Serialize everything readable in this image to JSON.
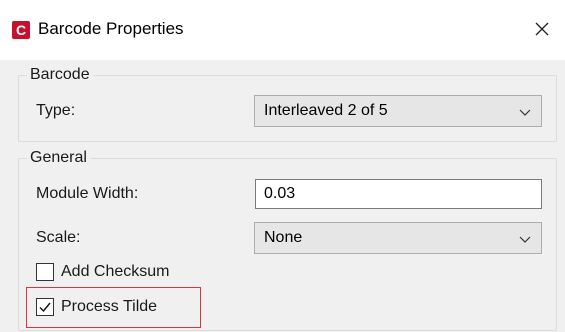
{
  "window": {
    "app_icon_letter": "C",
    "title": "Barcode Properties"
  },
  "barcode_group": {
    "legend": "Barcode",
    "type_label": "Type:",
    "type_value": "Interleaved 2 of 5"
  },
  "general_group": {
    "legend": "General",
    "module_width_label": "Module Width:",
    "module_width_value": "0.03",
    "scale_label": "Scale:",
    "scale_value": "None",
    "add_checksum_label": "Add Checksum",
    "add_checksum_checked": false,
    "process_tilde_label": "Process Tilde",
    "process_tilde_checked": true
  },
  "colors": {
    "brand": "#c8102e",
    "highlight": "#d9363e",
    "dialog_bg": "#f0f0f0"
  },
  "icons": [
    "app-logo-icon",
    "close-icon",
    "chevron-down-icon",
    "checkmark-icon"
  ]
}
